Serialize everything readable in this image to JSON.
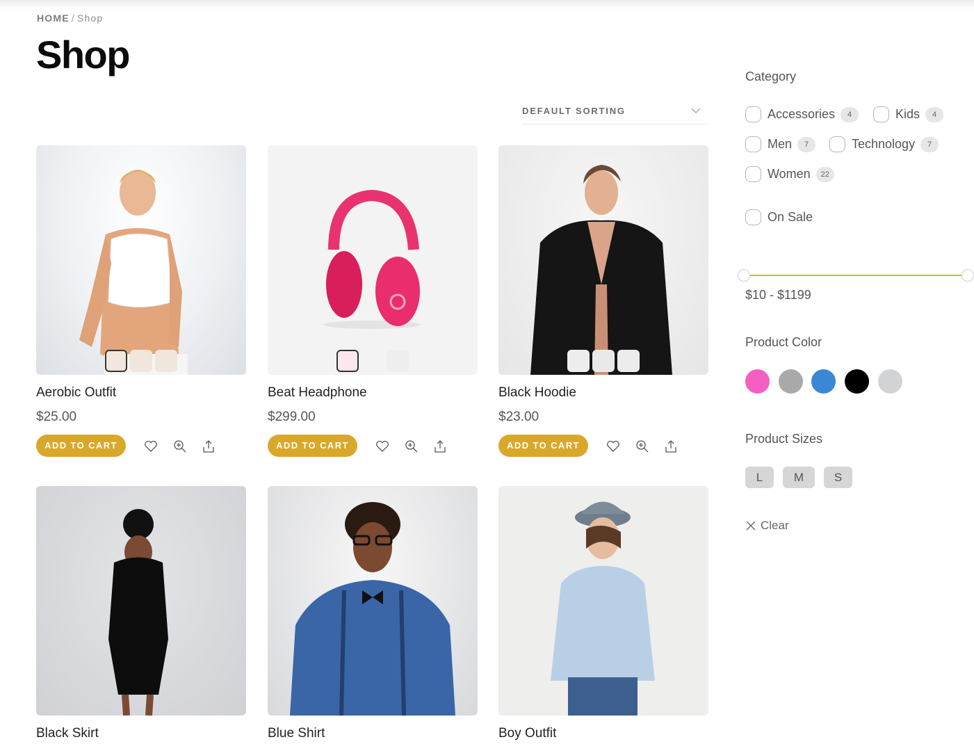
{
  "breadcrumb": {
    "home": "HOME",
    "separator": "/",
    "current": "Shop"
  },
  "page_title": "Shop",
  "sorting": {
    "selected": "DEFAULT SORTING",
    "icon": "chevron-down-icon"
  },
  "products": [
    {
      "name": "Aerobic Outfit",
      "price": "$25.00",
      "add_to_cart": "ADD TO CART",
      "thumbnail_count": 3,
      "active_thumbnail": 0
    },
    {
      "name": "Beat Headphone",
      "price": "$299.00",
      "add_to_cart": "ADD TO CART",
      "thumbnail_count": 3,
      "active_thumbnail": 0
    },
    {
      "name": "Black Hoodie",
      "price": "$23.00",
      "add_to_cart": "ADD TO CART",
      "thumbnail_count": 3,
      "active_thumbnail": -1
    },
    {
      "name": "Black Skirt"
    },
    {
      "name": "Blue Shirt"
    },
    {
      "name": "Boy Outfit"
    }
  ],
  "product_actions": [
    {
      "name": "wishlist",
      "icon": "heart-icon"
    },
    {
      "name": "quick-view",
      "icon": "zoom-in-icon"
    },
    {
      "name": "share",
      "icon": "share-icon"
    }
  ],
  "sidebar": {
    "category_title": "Category",
    "categories": [
      {
        "label": "Accessories",
        "count": "4",
        "checked": false
      },
      {
        "label": "Kids",
        "count": "4",
        "checked": false
      },
      {
        "label": "Men",
        "count": "7",
        "checked": false
      },
      {
        "label": "Technology",
        "count": "7",
        "checked": false
      },
      {
        "label": "Women",
        "count": "22",
        "checked": false
      }
    ],
    "on_sale": {
      "label": "On Sale",
      "checked": false
    },
    "price_filter": {
      "min": 10,
      "max": 1199,
      "label": "$10 - $1199"
    },
    "color_title": "Product Color",
    "colors": [
      {
        "name": "pink",
        "hex": "#f55fc0"
      },
      {
        "name": "gray",
        "hex": "#a9a9a9"
      },
      {
        "name": "blue",
        "hex": "#3a87d6"
      },
      {
        "name": "black",
        "hex": "#000000"
      },
      {
        "name": "light-gray",
        "hex": "#d2d3d5"
      }
    ],
    "sizes_title": "Product Sizes",
    "sizes": [
      "L",
      "M",
      "S"
    ],
    "clear_label": "Clear"
  },
  "accent_color": "#d9a82b"
}
